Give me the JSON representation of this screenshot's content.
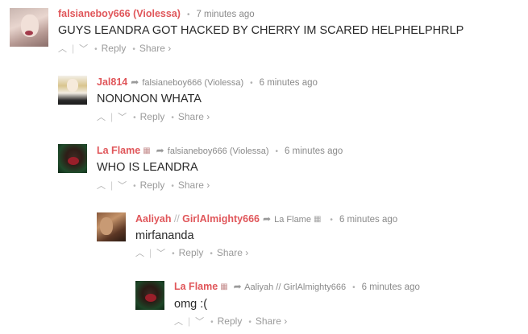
{
  "comments": [
    {
      "author": "falsianeboy666 (Violessa)",
      "time": "7 minutes ago",
      "text": "GUYS LEANDRA GOT HACKED BY CHERRY IM SCARED HELPHELPHRLP"
    },
    {
      "author": "Jal814",
      "reply_to": "falsianeboy666 (Violessa)",
      "time": "6 minutes ago",
      "text": "NONONON WHATA"
    },
    {
      "author": "La Flame",
      "reply_to": "falsianeboy666 (Violessa)",
      "time": "6 minutes ago",
      "text": "WHO IS LEANDRA"
    },
    {
      "author_a": "Aaliyah",
      "author_b": "GirlAlmighty666",
      "reply_to": "La Flame",
      "time": "6 minutes ago",
      "text": "mirfananda"
    },
    {
      "author": "La Flame",
      "reply_to": "Aaliyah // GirlAlmighty666",
      "time": "6 minutes ago",
      "text": "omg :("
    }
  ],
  "labels": {
    "reply": "Reply",
    "share": "Share ›",
    "upvote": "^",
    "downvote": "⌄",
    "author_separator": "//"
  }
}
